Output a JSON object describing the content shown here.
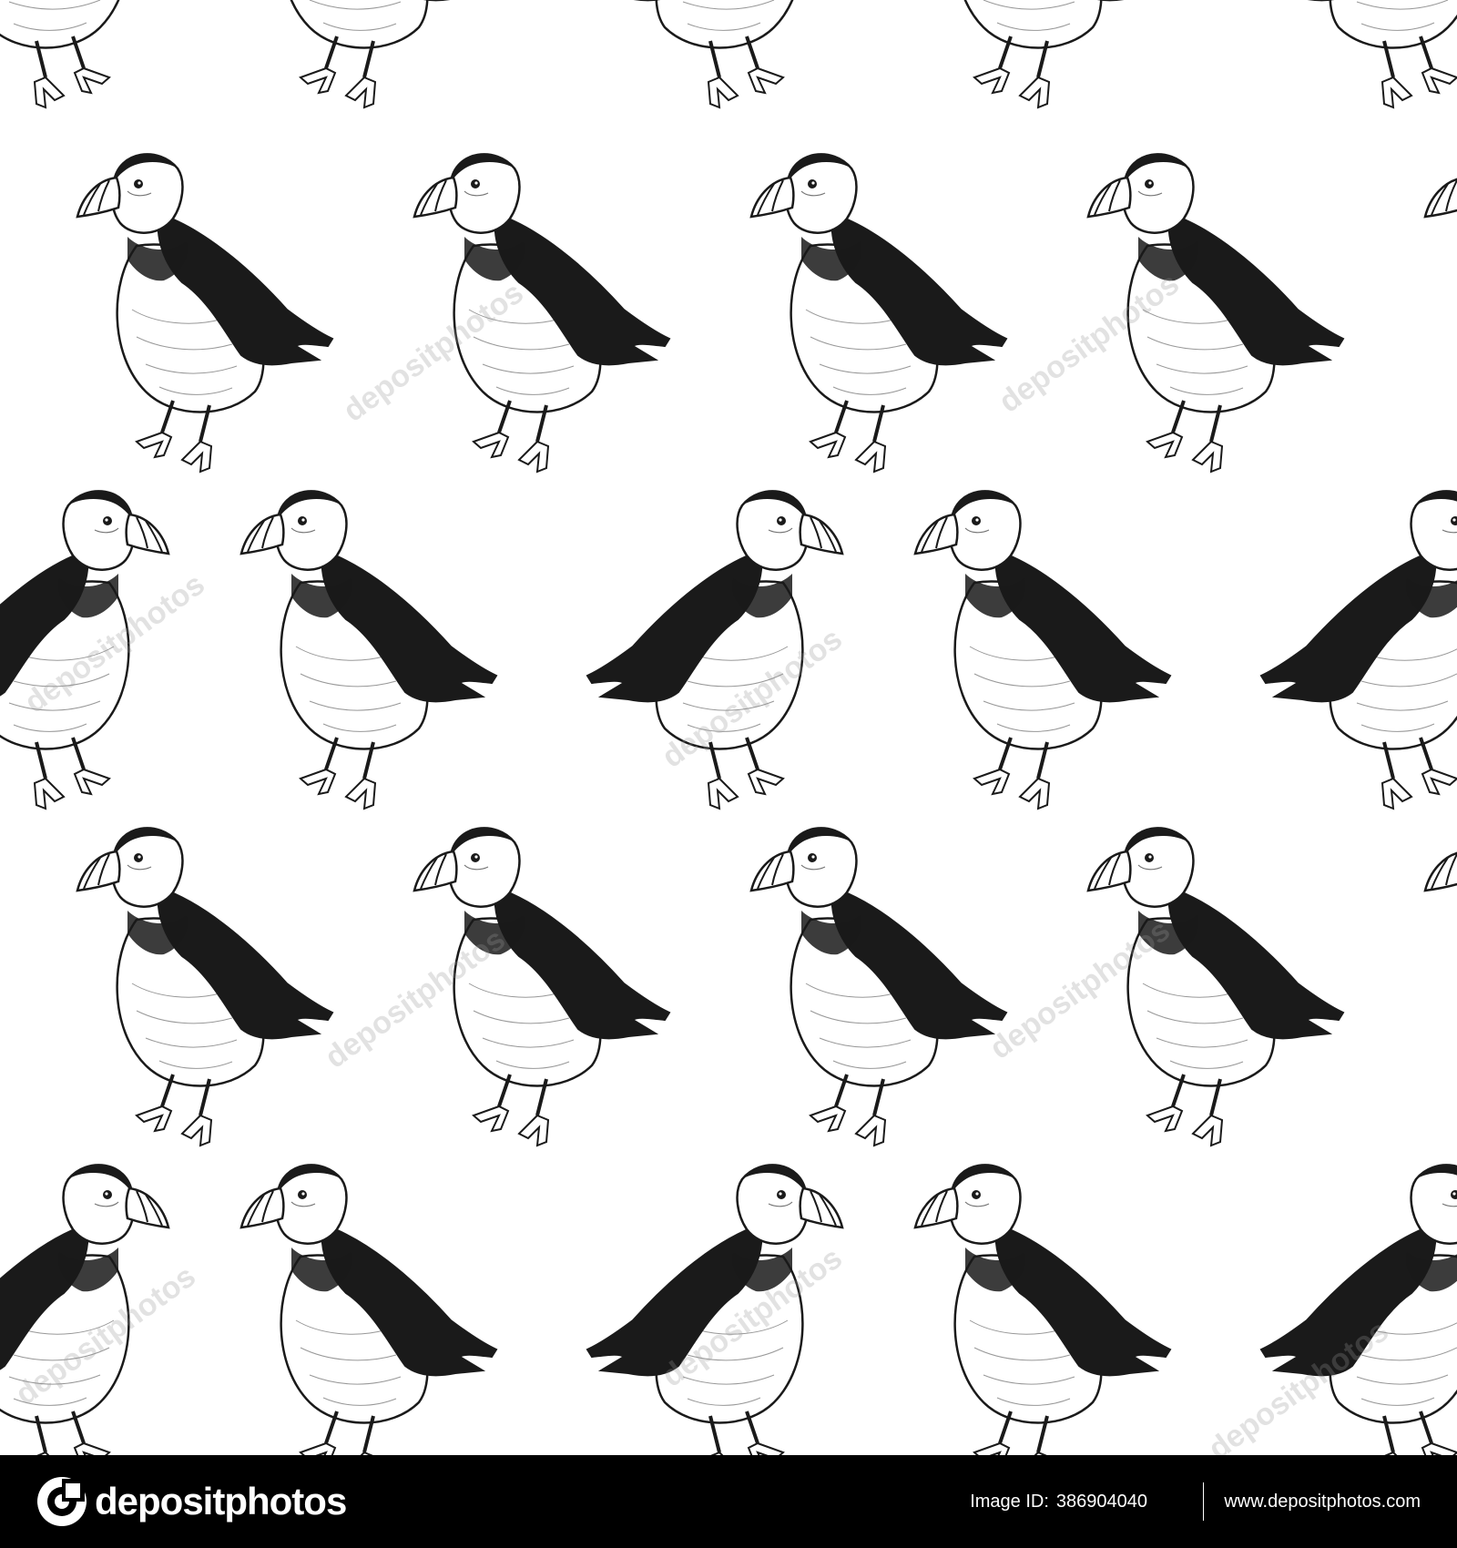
{
  "image": {
    "subject": "puffin-seamless-pattern",
    "style": "black-and-white engraving",
    "colors": {
      "background": "#ffffff",
      "ink": "#1a1a1a",
      "footer": "#000000",
      "footer_text": "#ffffff"
    }
  },
  "watermark": {
    "text": "depositphotos"
  },
  "footer": {
    "logo_text": "depositphotos",
    "image_id_label": "Image ID:",
    "image_id": "386904040",
    "site_url": "www.depositphotos.com",
    "logo_icon": "depositphotos-logo-icon"
  }
}
